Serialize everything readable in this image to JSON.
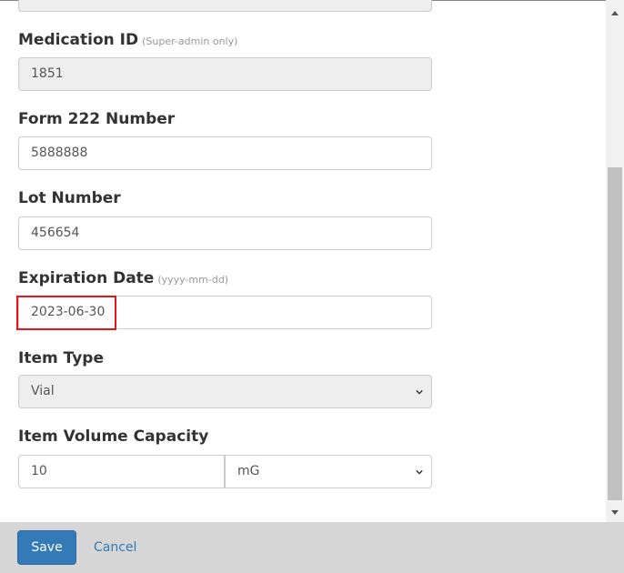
{
  "form": {
    "medication_id": {
      "label": "Medication ID",
      "note": "(Super-admin only)",
      "value": "1851"
    },
    "form_222": {
      "label": "Form 222 Number",
      "value": "5888888"
    },
    "lot_number": {
      "label": "Lot Number",
      "value": "456654"
    },
    "expiration_date": {
      "label": "Expiration Date",
      "note": "(yyyy-mm-dd)",
      "value": "2023-06-30"
    },
    "item_type": {
      "label": "Item Type",
      "value": "Vial"
    },
    "item_volume_capacity": {
      "label": "Item Volume Capacity",
      "value": "10",
      "unit": "mG"
    }
  },
  "footer": {
    "save_label": "Save",
    "cancel_label": "Cancel"
  },
  "icons": {
    "select_caret": "chevron-down-icon",
    "scroll_up": "scroll-up-arrow-icon",
    "scroll_down": "scroll-down-arrow-icon"
  },
  "colors": {
    "primary": "#337ab7",
    "highlight": "#e8141d",
    "disabled_bg": "#eeeeee",
    "footer_bg": "#d6d6d6"
  }
}
